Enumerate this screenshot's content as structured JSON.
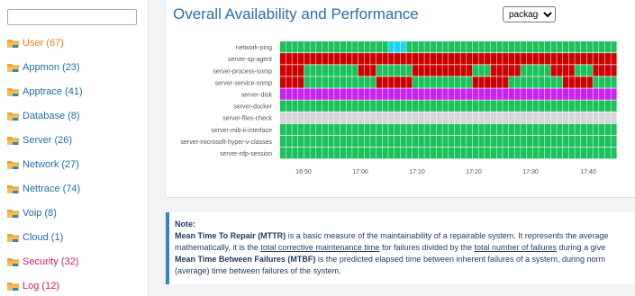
{
  "sidebar": {
    "search": {
      "value": "",
      "placeholder": ""
    },
    "items": [
      {
        "label": "User (67)",
        "color": "#e67e22",
        "icon": "folder-icon"
      },
      {
        "label": "Appmon (23)",
        "color": "#1f6fa8",
        "icon": "folder-icon"
      },
      {
        "label": "Apptrace (41)",
        "color": "#1f6fa8",
        "icon": "folder-icon"
      },
      {
        "label": "Database (8)",
        "color": "#1f6fa8",
        "icon": "folder-icon"
      },
      {
        "label": "Server (26)",
        "color": "#1f6fa8",
        "icon": "folder-icon"
      },
      {
        "label": "Network (27)",
        "color": "#1f6fa8",
        "icon": "folder-icon"
      },
      {
        "label": "Nettrace (74)",
        "color": "#1f6fa8",
        "icon": "folder-icon"
      },
      {
        "label": "Voip (8)",
        "color": "#1f6fa8",
        "icon": "folder-icon"
      },
      {
        "label": "Cloud (1)",
        "color": "#1f6fa8",
        "icon": "folder-icon"
      },
      {
        "label": "Security (32)",
        "color": "#d81b60",
        "icon": "folder-icon"
      },
      {
        "label": "Log (12)",
        "color": "#d81b60",
        "icon": "folder-icon"
      }
    ]
  },
  "main": {
    "title": "Overall Availability and Performance",
    "group_select": {
      "selected": "package",
      "options": [
        "package"
      ]
    }
  },
  "chart_data": {
    "type": "heatmap",
    "title": "Overall Availability and Performance",
    "rows": [
      "network-ping",
      "server-sp-agent",
      "server-process-snmp",
      "server-service-snmp",
      "server-disk",
      "server-docker",
      "server-files-check",
      "server-mib-ii-interface",
      "server-microsoft-hyper-v-classes",
      "server-rdp-session"
    ],
    "x_ticks": [
      "16:50",
      "17:00",
      "17:10",
      "17:20",
      "17:30",
      "17:40"
    ],
    "columns": 56,
    "status_colors": {
      "G": "#1cc15c",
      "R": "#cc0000",
      "C": "#1ad3f7",
      "M": "#c722f0",
      "L": "#d6d6d6"
    },
    "cells": [
      "GGGGGGGGGGGGGGGGGGGGGGGGGGGGGGGGGGGGGGGGGGGGGGGGGGGGGGGG",
      "RRRRRRRRRRRRRRRRRRRRRRRRRRRRRRRRRRRRRRRRRRRRRRRRRRRRRRRR",
      "RRRRGGGGGGGGGRRRGGGGGGRRRRRRRRRRGGGRRRRRGGGGGRRRRGGGRRRR",
      "RRRRGGGGGGGGGGGGRRRRRRGGGGGGGGGGRRRRRRGGGGGGGGGRRRRRGGGG",
      "MMMMMMMMMMMMMMMMMMMMMMMMMMMMMMMMMMMMMMMMMMMMMMMMMMMMMMMM",
      "GGGGGGGGGGGGGGGGGGGGGGGGGGGGGGGGGGGGGGGGGGGGGGGGGGGGGGGG",
      "LLLLLLLLLLLLLLLLLLLLLLLLLLLLLLLLLLLLLLLLLLLLLLLLLLLLLLLL",
      "GGGGGGGGGGGGGGGGGGGGGGGGGGGGGGGGGGGGGGGGGGGGGGGGGGGGGGGG",
      "GGGGGGGGGGGGGGGGGGGGGGGGGGGGGGGGGGGGGGGGGGGGGGGGGGGGGGGG",
      "GGGGGGGGGGGGGGGGGGGGGGGGGGGGGGGGGGGGGGGGGGGGGGGGGGGGGGGG"
    ],
    "ping_cyan_cols": [
      18,
      19,
      20
    ]
  },
  "note": {
    "heading": "Note:",
    "mttr_term": "Mean Time To Repair (MTTR)",
    "mttr_text1": " is a basic measure of the maintainability of a repairable system. It represents the average",
    "line2_a": "mathematically, it is the ",
    "line2_link1": "total corrective maintenance time",
    "line2_b": " for failures divided by the ",
    "line2_link2": "total number of failures",
    "line2_c": " during a give",
    "mtbf_term": "Mean Time Between Failures (MTBF)",
    "mtbf_text": " is the predicted elapsed time between inherent failures of a system, during norm",
    "line4": "(average) time between failures of the system."
  }
}
